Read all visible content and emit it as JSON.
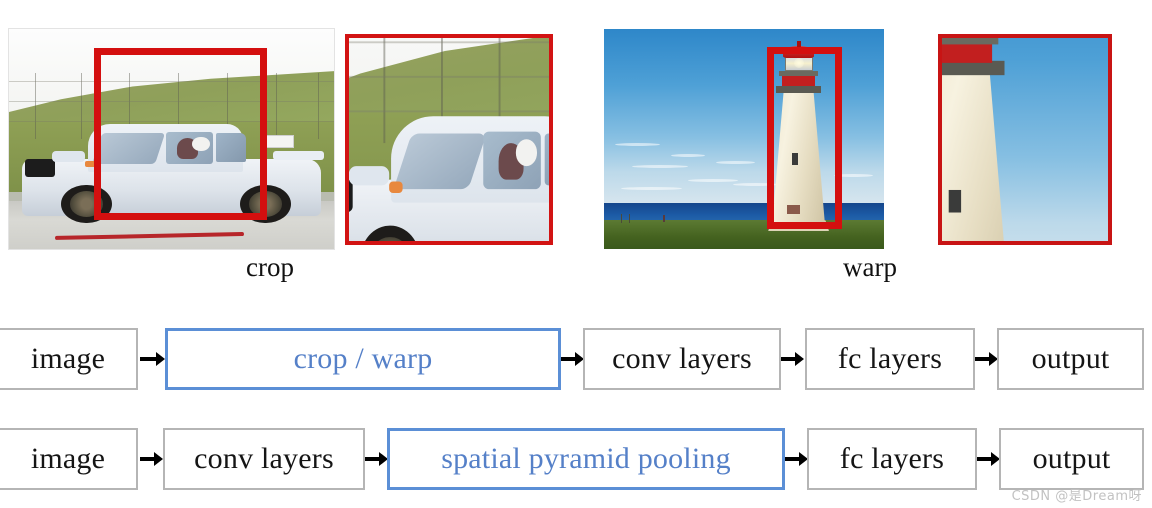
{
  "figure": {
    "photos": [
      {
        "id": "car-original",
        "alt": "white rally car on a racetrack with green hillside and fence, red bounding box over the car",
        "bbox_color": "#d40f0f"
      },
      {
        "id": "car-crop",
        "alt": "cropped region of the white rally car, red border",
        "bbox_color": "#d21313"
      },
      {
        "id": "lighthouse-original",
        "alt": "white lighthouse with red top beside the sea under a blue sky, red bounding box over the lighthouse",
        "bbox_color": "#d40f0f"
      },
      {
        "id": "lighthouse-warp",
        "alt": "warped (stretched) crop of the lighthouse, red border",
        "bbox_color": "#c81414"
      }
    ],
    "captions": {
      "crop": "crop",
      "warp": "warp"
    }
  },
  "flow_rows": [
    {
      "id": "row-1",
      "nodes": [
        {
          "label": "image",
          "highlight": false
        },
        {
          "label": "crop / warp",
          "highlight": true
        },
        {
          "label": "conv layers",
          "highlight": false
        },
        {
          "label": "fc layers",
          "highlight": false
        },
        {
          "label": "output",
          "highlight": false
        }
      ]
    },
    {
      "id": "row-2",
      "nodes": [
        {
          "label": "image",
          "highlight": false
        },
        {
          "label": "conv layers",
          "highlight": false
        },
        {
          "label": "spatial pyramid pooling",
          "highlight": true
        },
        {
          "label": "fc layers",
          "highlight": false
        },
        {
          "label": "output",
          "highlight": false
        }
      ]
    }
  ],
  "colors": {
    "highlight_border": "#5b8fd6",
    "highlight_text": "#5580c8",
    "node_border": "#b5b5b5",
    "node_text": "#151515",
    "bbox_red": "#d40f0f",
    "background": "#ffffff"
  },
  "watermark": {
    "text": "CSDN @是Dream呀"
  }
}
